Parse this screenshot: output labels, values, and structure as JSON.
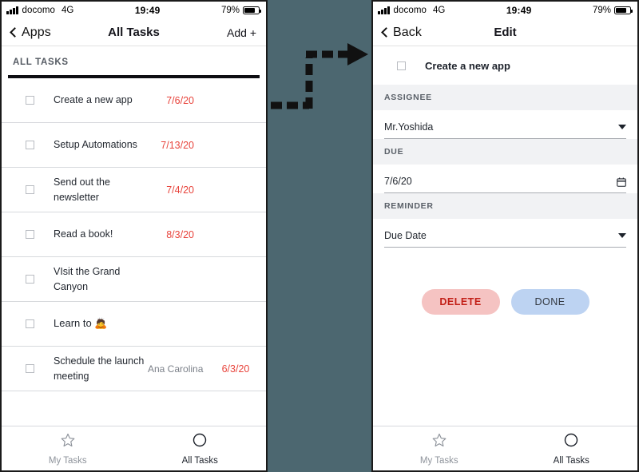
{
  "status_bar": {
    "carrier": "docomo",
    "network": "4G",
    "time": "19:49",
    "battery_pct": "79%",
    "signal_icon": "signal-bars-icon",
    "battery_icon": "battery-icon"
  },
  "colors": {
    "due_date_red": "#e8443c",
    "delete_bg": "#f5c3c2",
    "delete_text": "#c21f17",
    "done_bg": "#bdd3f2",
    "middle_panel_bg": "#4c6770",
    "section_rule": "#0d0d12"
  },
  "left_screen": {
    "nav": {
      "back_label": "Apps",
      "title": "All Tasks",
      "action_label": "Add +",
      "back_icon": "chevron-left-icon"
    },
    "section_header": "ALL TASKS",
    "tasks": [
      {
        "title": "Create a new app",
        "assignee": "",
        "date": "7/6/20"
      },
      {
        "title": "Setup Automations",
        "assignee": "",
        "date": "7/13/20"
      },
      {
        "title": "Send out the newsletter",
        "assignee": "",
        "date": "7/4/20"
      },
      {
        "title": "Read a book!",
        "assignee": "",
        "date": "8/3/20"
      },
      {
        "title": "VIsit the Grand Canyon",
        "assignee": "",
        "date": ""
      },
      {
        "title": "Learn to 🙇",
        "assignee": "",
        "date": ""
      },
      {
        "title": "Schedule the launch meeting",
        "assignee": "Ana Carolina",
        "date": "6/3/20"
      }
    ],
    "tabs": [
      {
        "label": "My Tasks",
        "icon": "star-icon",
        "active": false
      },
      {
        "label": "All Tasks",
        "icon": "circle-icon",
        "active": true
      }
    ]
  },
  "right_screen": {
    "nav": {
      "back_label": "Back",
      "title": "Edit",
      "back_icon": "chevron-left-icon"
    },
    "task_title": "Create a new app",
    "fields": [
      {
        "label": "ASSIGNEE",
        "value": "Mr.Yoshida",
        "control": "dropdown",
        "icon": "caret-down-icon"
      },
      {
        "label": "DUE",
        "value": "7/6/20",
        "control": "date",
        "icon": "calendar-icon"
      },
      {
        "label": "REMINDER",
        "value": "Due Date",
        "control": "dropdown",
        "icon": "caret-down-icon"
      }
    ],
    "buttons": {
      "delete_label": "DELETE",
      "done_label": "DONE"
    },
    "tabs": [
      {
        "label": "My Tasks",
        "icon": "star-icon",
        "active": false
      },
      {
        "label": "All Tasks",
        "icon": "circle-icon",
        "active": true
      }
    ]
  },
  "annotation": {
    "arrow_icon": "dashed-elbow-arrow-right"
  }
}
